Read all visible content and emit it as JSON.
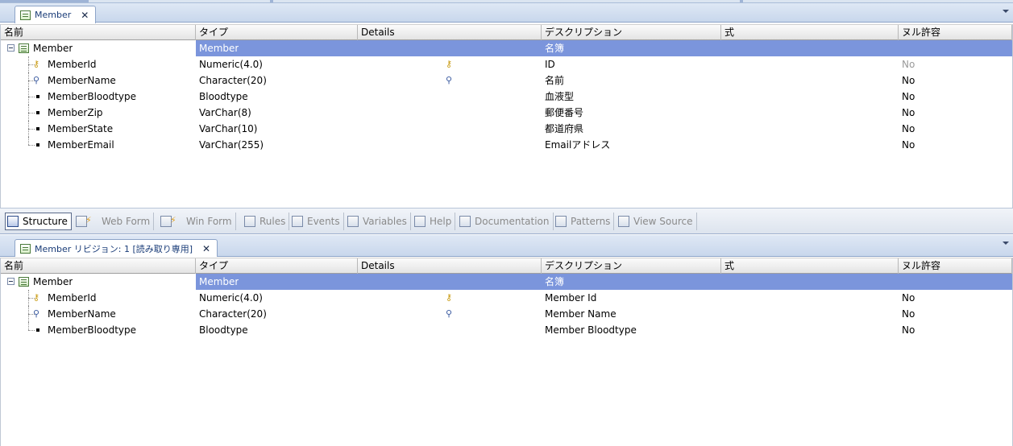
{
  "top_tab": {
    "title": "Member",
    "close": "✕"
  },
  "bottom_tab": {
    "title": "Member リビジョン: 1 [読み取り専用]",
    "close": "✕"
  },
  "columns": [
    "名前",
    "タイプ",
    "Details",
    "デスクリプション",
    "式",
    "ヌル許容"
  ],
  "top_grid": {
    "root": {
      "name": "Member",
      "type": "Member",
      "description": "名簿"
    },
    "rows": [
      {
        "name": "MemberId",
        "type": "Numeric(4.0)",
        "icon": "key-icon",
        "description": "ID",
        "nullable": "No",
        "muted": true
      },
      {
        "name": "MemberName",
        "type": "Character(20)",
        "icon": "search-icon",
        "description": "名前",
        "nullable": "No"
      },
      {
        "name": "MemberBloodtype",
        "type": "Bloodtype",
        "icon": "bullet",
        "description": "血液型",
        "nullable": "No"
      },
      {
        "name": "MemberZip",
        "type": "VarChar(8)",
        "icon": "bullet",
        "description": "郵便番号",
        "nullable": "No"
      },
      {
        "name": "MemberState",
        "type": "VarChar(10)",
        "icon": "bullet",
        "description": "都道府県",
        "nullable": "No"
      },
      {
        "name": "MemberEmail",
        "type": "VarChar(255)",
        "icon": "bullet",
        "description": "Emailアドレス",
        "nullable": "No"
      }
    ]
  },
  "toolbar": [
    {
      "label": "Structure",
      "icon": "structure-icon",
      "active": true
    },
    {
      "label": "Web Form",
      "icon": "web-form-icon"
    },
    {
      "label": "Win Form",
      "icon": "win-form-icon"
    },
    {
      "label": "Rules",
      "icon": "rules-icon"
    },
    {
      "label": "Events",
      "icon": "events-icon"
    },
    {
      "label": "Variables",
      "icon": "variables-icon"
    },
    {
      "label": "Help",
      "icon": "help-icon"
    },
    {
      "label": "Documentation",
      "icon": "documentation-icon"
    },
    {
      "label": "Patterns",
      "icon": "patterns-icon"
    },
    {
      "label": "View Source",
      "icon": "view-source-icon"
    }
  ],
  "bottom_grid": {
    "root": {
      "name": "Member",
      "type": "Member",
      "description": "名簿"
    },
    "rows": [
      {
        "name": "MemberId",
        "type": "Numeric(4.0)",
        "icon": "key-icon",
        "description": "Member Id",
        "nullable": "No"
      },
      {
        "name": "MemberName",
        "type": "Character(20)",
        "icon": "search-icon",
        "description": "Member Name",
        "nullable": "No"
      },
      {
        "name": "MemberBloodtype",
        "type": "Bloodtype",
        "icon": "bullet",
        "description": "Member Bloodtype",
        "nullable": "No"
      }
    ]
  }
}
